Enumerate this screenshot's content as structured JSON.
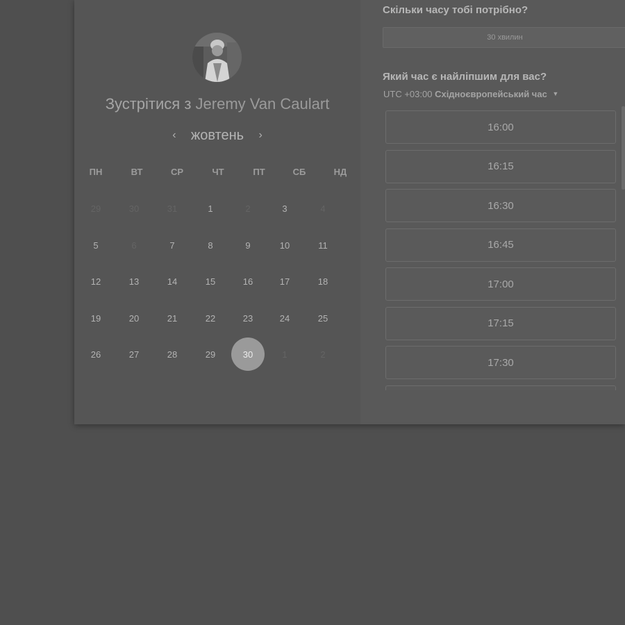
{
  "meeting": {
    "title_prefix": "Зустрітися з",
    "host_name": "Jeremy Van Caulart"
  },
  "calendar": {
    "month_label": "жовтень",
    "prev_icon": "‹",
    "next_icon": "›",
    "weekdays": [
      "ПН",
      "ВТ",
      "СР",
      "ЧТ",
      "ПТ",
      "СБ",
      "НД"
    ],
    "weeks": [
      [
        {
          "d": "29",
          "m": true
        },
        {
          "d": "30",
          "m": true
        },
        {
          "d": "31",
          "m": true
        },
        {
          "d": "1",
          "m": false
        },
        {
          "d": "2",
          "m": true
        },
        {
          "d": "3",
          "m": false
        },
        {
          "d": "4",
          "m": true
        }
      ],
      [
        {
          "d": "5",
          "m": false
        },
        {
          "d": "6",
          "m": true
        },
        {
          "d": "7",
          "m": false
        },
        {
          "d": "8",
          "m": false
        },
        {
          "d": "9",
          "m": false
        },
        {
          "d": "10",
          "m": false
        },
        {
          "d": "11",
          "m": false
        }
      ],
      [
        {
          "d": "12",
          "m": false
        },
        {
          "d": "13",
          "m": false
        },
        {
          "d": "14",
          "m": false
        },
        {
          "d": "15",
          "m": false
        },
        {
          "d": "16",
          "m": false
        },
        {
          "d": "17",
          "m": false
        },
        {
          "d": "18",
          "m": false
        }
      ],
      [
        {
          "d": "19",
          "m": false
        },
        {
          "d": "20",
          "m": false
        },
        {
          "d": "21",
          "m": false
        },
        {
          "d": "22",
          "m": false
        },
        {
          "d": "23",
          "m": false
        },
        {
          "d": "24",
          "m": false
        },
        {
          "d": "25",
          "m": false
        }
      ],
      [
        {
          "d": "26",
          "m": false
        },
        {
          "d": "27",
          "m": false
        },
        {
          "d": "28",
          "m": false
        },
        {
          "d": "29",
          "m": false
        },
        {
          "d": "30",
          "m": false,
          "selected": true
        },
        {
          "d": "1",
          "m": true
        },
        {
          "d": "2",
          "m": true
        }
      ]
    ]
  },
  "booking": {
    "duration_question": "Скільки часу тобі потрібно?",
    "duration_value": "30 хвилин",
    "time_question": "Який час є найліпшим для вас?",
    "timezone_offset": "UTC +03:00",
    "timezone_name": "Східноєвропейський час",
    "caret_icon": "▼",
    "slots": [
      "16:00",
      "16:15",
      "16:30",
      "16:45",
      "17:00",
      "17:15",
      "17:30",
      ""
    ]
  }
}
